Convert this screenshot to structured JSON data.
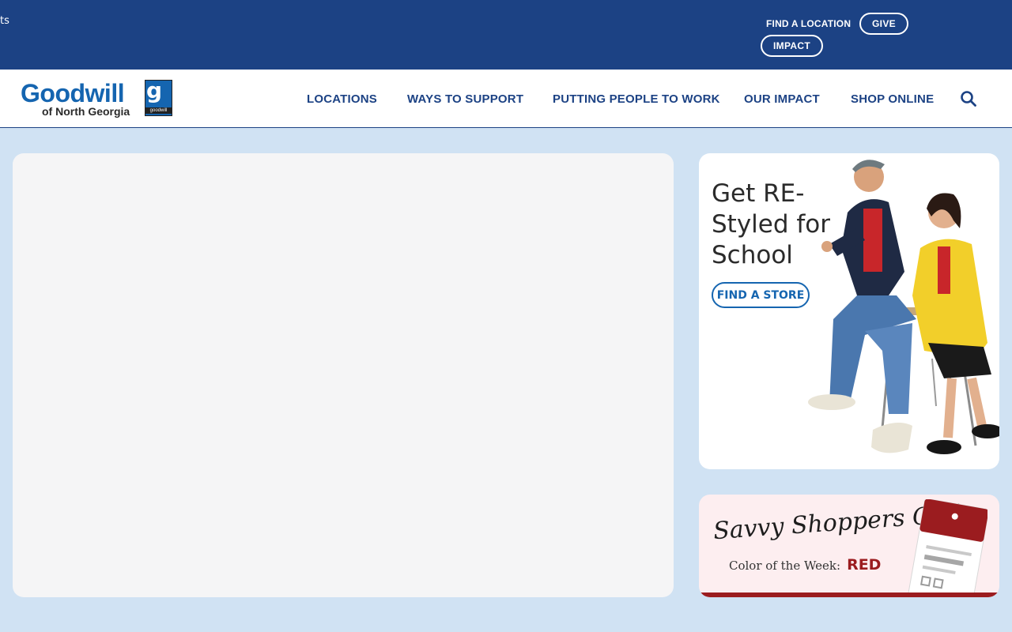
{
  "topbar": {
    "clipped_text": "ts",
    "find_location": "FIND A LOCATION",
    "give": "GIVE",
    "impact": "IMPACT"
  },
  "logo": {
    "name": "Goodwill",
    "subtitle": "of North Georgia",
    "mark_text": "goodwill"
  },
  "nav": {
    "items": [
      "LOCATIONS",
      "WAYS TO SUPPORT",
      "PUTTING PEOPLE TO WORK",
      "OUR IMPACT",
      "SHOP ONLINE"
    ]
  },
  "promo": {
    "title": "Get RE-Styled for School",
    "button": "FIND A STORE"
  },
  "club": {
    "script_title": "Savvy Shoppers Club",
    "color_label": "Color of the Week:",
    "color_value": "RED"
  },
  "colors": {
    "topbar_bg": "#1c4284",
    "brand_blue": "#1565b0",
    "page_bg": "#d0e2f3",
    "accent_red": "#9b1c1f"
  }
}
